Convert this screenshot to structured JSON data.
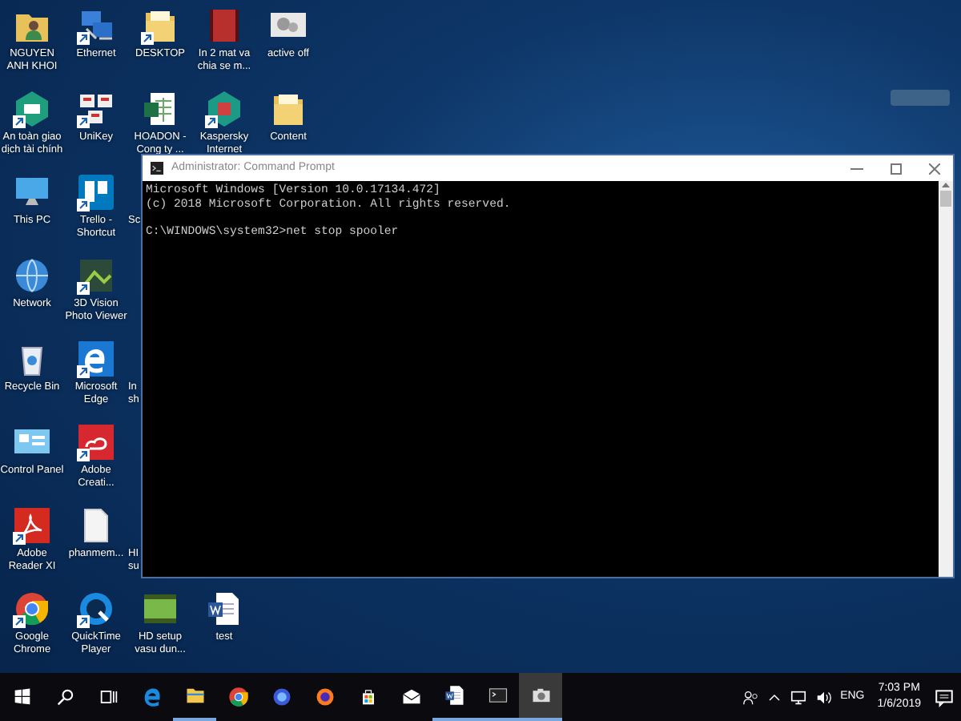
{
  "desktop_rows": [
    [
      {
        "label": "NGUYEN ANH KHOI",
        "kind": "user-folder"
      },
      {
        "label": "Ethernet",
        "kind": "network",
        "shortcut": true
      },
      {
        "label": "DESKTOP",
        "kind": "folder",
        "shortcut": true
      },
      {
        "label": "In 2 mat va chia se m...",
        "kind": "video"
      },
      {
        "label": "active off",
        "kind": "gears"
      }
    ],
    [
      {
        "label": "An toàn giao dịch tài chính",
        "kind": "bank",
        "shortcut": true
      },
      {
        "label": "UniKey",
        "kind": "keys",
        "shortcut": true
      },
      {
        "label": "HOADON - Cong ty ...",
        "kind": "excel"
      },
      {
        "label": "Kaspersky Internet",
        "kind": "kaspersky",
        "shortcut": true
      },
      {
        "label": "Content",
        "kind": "folder"
      }
    ],
    [
      {
        "label": "This PC",
        "kind": "pc"
      },
      {
        "label": "Trello - Shortcut",
        "kind": "trello",
        "shortcut": true
      },
      {
        "label": "Sc",
        "kind": "partial"
      }
    ],
    [
      {
        "label": "Network",
        "kind": "globe"
      },
      {
        "label": "3D Vision Photo Viewer",
        "kind": "viewer",
        "shortcut": true
      }
    ],
    [
      {
        "label": "Recycle Bin",
        "kind": "recycle"
      },
      {
        "label": "Microsoft Edge",
        "kind": "edge",
        "shortcut": true
      },
      {
        "label": "In sh",
        "kind": "partial"
      }
    ],
    [
      {
        "label": "Control Panel",
        "kind": "control"
      },
      {
        "label": "Adobe Creati...",
        "kind": "adobe-cc",
        "shortcut": true
      }
    ],
    [
      {
        "label": "Adobe Reader XI",
        "kind": "acrobat",
        "shortcut": true
      },
      {
        "label": "phanmem...",
        "kind": "document"
      },
      {
        "label": "HI su",
        "kind": "partial"
      }
    ],
    [
      {
        "label": "Google Chrome",
        "kind": "chrome",
        "shortcut": true
      },
      {
        "label": "QuickTime Player",
        "kind": "quicktime",
        "shortcut": true
      },
      {
        "label": "HD setup vasu dun...",
        "kind": "hd-video"
      },
      {
        "label": "test",
        "kind": "word"
      }
    ]
  ],
  "window": {
    "title": "Administrator: Command Prompt",
    "lines": [
      {
        "text": "Microsoft Windows [Version 10.0.17134.472]",
        "blank_before": false
      },
      {
        "text": "(c) 2018 Microsoft Corporation. All rights reserved.",
        "blank_before": false
      },
      {
        "text": "C:\\WINDOWS\\system32>net stop spooler",
        "blank_before": true
      }
    ]
  },
  "taskbar": {
    "items": [
      {
        "kind": "start",
        "running": false,
        "active": false
      },
      {
        "kind": "search",
        "running": false,
        "active": false
      },
      {
        "kind": "task-view",
        "running": false,
        "active": false
      },
      {
        "kind": "edge",
        "running": false,
        "active": false
      },
      {
        "kind": "explorer",
        "running": true,
        "active": false
      },
      {
        "kind": "chrome",
        "running": false,
        "active": false
      },
      {
        "kind": "firefox-blue",
        "running": false,
        "active": false
      },
      {
        "kind": "firefox",
        "running": false,
        "active": false
      },
      {
        "kind": "store",
        "running": false,
        "active": false
      },
      {
        "kind": "mail",
        "running": false,
        "active": false
      },
      {
        "kind": "word",
        "running": true,
        "active": false
      },
      {
        "kind": "cmd",
        "running": true,
        "active": false
      },
      {
        "kind": "camera",
        "running": true,
        "active": true
      }
    ],
    "language": "ENG",
    "time": "7:03 PM",
    "date": "1/6/2019"
  }
}
